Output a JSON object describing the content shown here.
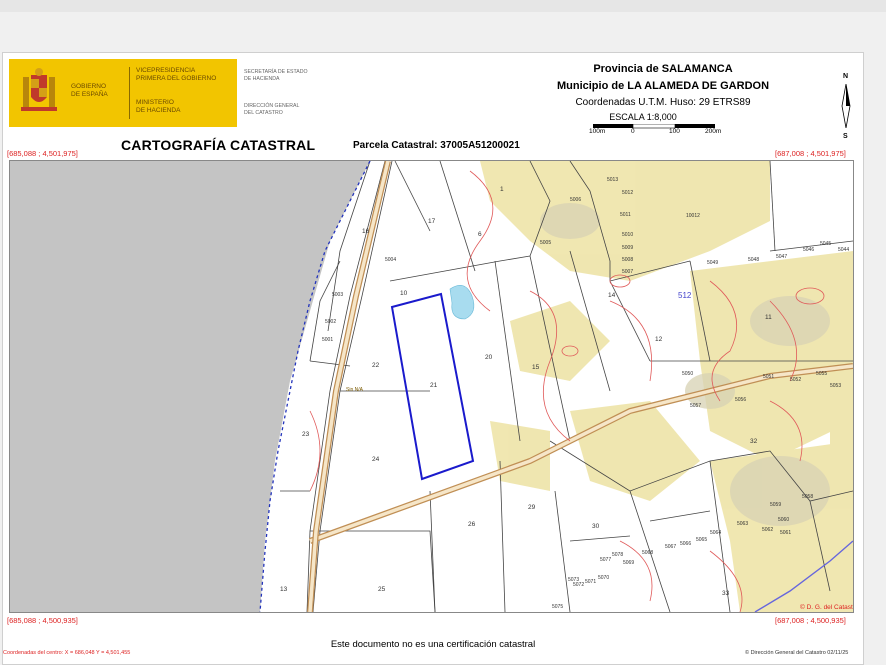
{
  "header": {
    "gobierno_line1": "GOBIERNO",
    "gobierno_line2": "DE ESPAÑA",
    "vicepresidencia_line1": "VICEPRESIDENCIA",
    "vicepresidencia_line2": "PRIMERA DEL GOBIERNO",
    "ministerio_line1": "MINISTERIO",
    "ministerio_line2": "DE HACIENDA",
    "secretaria_line1": "SECRETARÍA DE ESTADO",
    "secretaria_line2": "DE HACIENDA",
    "direccion_line1": "DIRECCIÓN GENERAL",
    "direccion_line2": "DEL CATASTRO",
    "provincia": "Provincia de SALAMANCA",
    "municipio": "Municipio de LA ALAMEDA DE GARDON",
    "coordenadas": "Coordenadas U.T.M. Huso: 29 ETRS89",
    "escala": "ESCALA 1:8,000",
    "scale_ticks": [
      "100m",
      "0",
      "100",
      "200m"
    ],
    "compass_north": "N",
    "compass_south": "S",
    "title": "CARTOGRAFÍA CATASTRAL",
    "parcela": "Parcela Catastral: 37005A51200021"
  },
  "corners": {
    "top_left": "[685,088 ; 4,501,975]",
    "top_right": "[687,008 ; 4,501,975]",
    "bottom_left": "[685,088 ; 4,500,935]",
    "bottom_right": "[687,008 ; 4,500,935]"
  },
  "map": {
    "parcel_labels": [
      "13",
      "17",
      "16",
      "5004",
      "5003",
      "5002",
      "5001",
      "10",
      "22",
      "21",
      "20",
      "15",
      "14",
      "12",
      "23",
      "24",
      "25",
      "26",
      "29",
      "30",
      "32",
      "33",
      "11",
      "10012",
      "5005",
      "5006",
      "5013",
      "5012",
      "5011",
      "5010",
      "5009",
      "5008",
      "5007",
      "5049",
      "5048",
      "5047",
      "5046",
      "5045",
      "5044",
      "5050",
      "5051",
      "5052",
      "5053",
      "5055",
      "5056",
      "5057",
      "5058",
      "5059",
      "5060",
      "5061",
      "5062",
      "5063",
      "5064",
      "5065",
      "5066",
      "5067",
      "5068",
      "5069",
      "5070",
      "5071",
      "5072",
      "5073",
      "5075",
      "5077",
      "5078",
      "1",
      "6"
    ],
    "polygon_label": "512",
    "road_label": "Sin N/A",
    "credit": "© D. G. del Catastro",
    "colors": {
      "parcel_line": "#444444",
      "selected_parcel": "#1a1acc",
      "boundary": "#2233bb",
      "contour": "#e05a5a",
      "road": "#d4a060",
      "outside": "#c4c4c4",
      "vegetation": "#eee4a8"
    }
  },
  "footer": {
    "disclaimer": "Este documento no es una certificación catastral",
    "centro": "Coordenadas del centro: X = 686,048 Y = 4,501,455",
    "copyright": "© Dirección General del Catastro 02/11/25"
  }
}
